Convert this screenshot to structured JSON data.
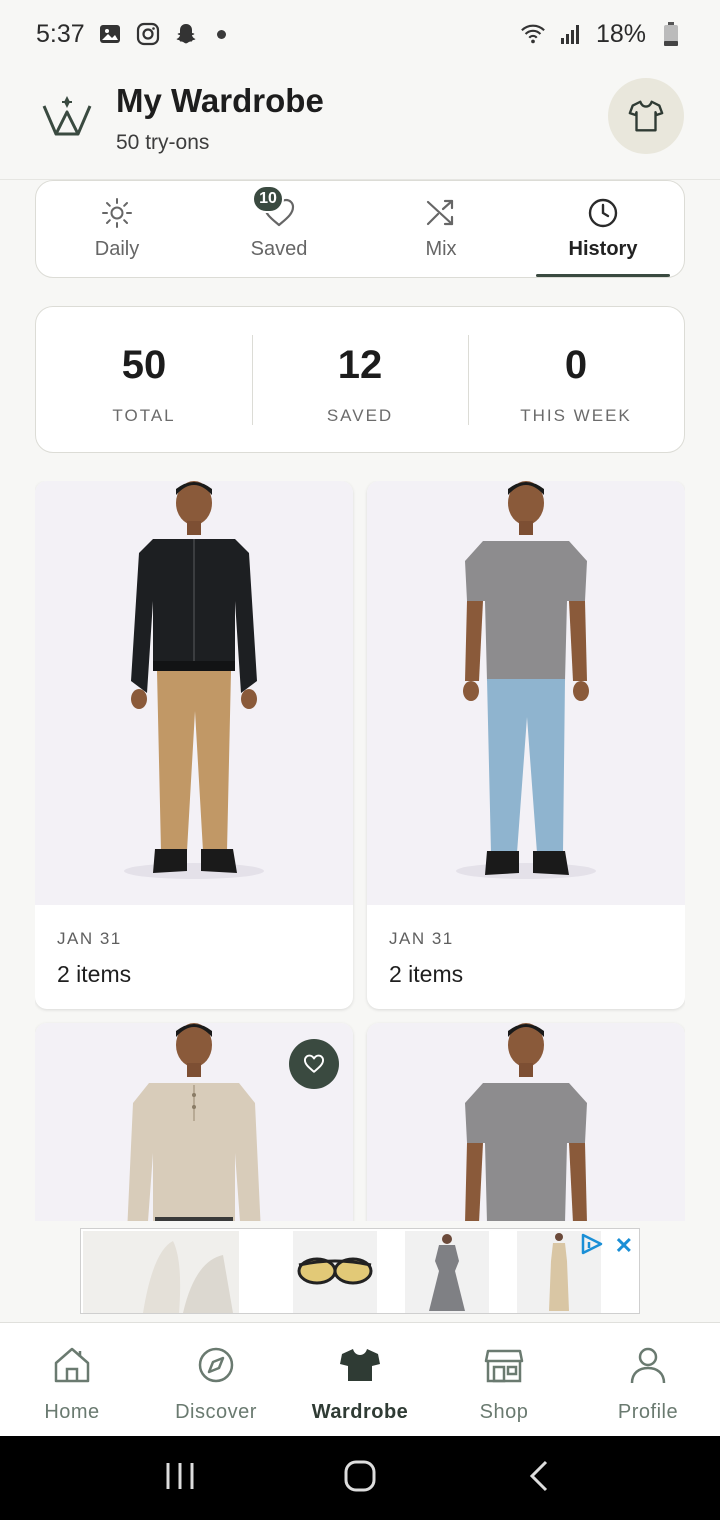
{
  "status_bar": {
    "time": "5:37",
    "battery": "18%",
    "icons": [
      "gallery-icon",
      "instagram-icon",
      "snapchat-icon",
      "dot-icon",
      "wifi-icon",
      "signal-icon",
      "battery-icon"
    ]
  },
  "header": {
    "title": "My Wardrobe",
    "subtitle": "50 try-ons",
    "logo_icon": "crown-logo-icon",
    "action_icon": "tshirt-icon"
  },
  "tabs": {
    "items": [
      {
        "label": "Daily",
        "icon": "sun-icon"
      },
      {
        "label": "Saved",
        "icon": "heart-icon",
        "badge": "10"
      },
      {
        "label": "Mix",
        "icon": "shuffle-icon"
      },
      {
        "label": "History",
        "icon": "clock-icon"
      }
    ],
    "active": "History"
  },
  "stats": {
    "items": [
      {
        "value": "50",
        "label": "TOTAL"
      },
      {
        "value": "12",
        "label": "SAVED"
      },
      {
        "value": "0",
        "label": "THIS WEEK"
      }
    ]
  },
  "cards": [
    {
      "date": "JAN 31",
      "items": "2 items",
      "outfit": "black bomber jacket, khaki chinos",
      "saved": false
    },
    {
      "date": "JAN 31",
      "items": "2 items",
      "outfit": "grey t-shirt, light blue jeans",
      "saved": false
    },
    {
      "outfit": "beige henley long sleeve",
      "saved": true
    },
    {
      "outfit": "grey t-shirt",
      "saved": false
    }
  ],
  "ad": {
    "icons": [
      "adchoices-icon",
      "close-icon"
    ]
  },
  "bottom_nav": {
    "items": [
      {
        "label": "Home",
        "icon": "home-icon"
      },
      {
        "label": "Discover",
        "icon": "compass-icon"
      },
      {
        "label": "Wardrobe",
        "icon": "tshirt-icon"
      },
      {
        "label": "Shop",
        "icon": "store-icon"
      },
      {
        "label": "Profile",
        "icon": "person-icon"
      }
    ],
    "active": "Wardrobe"
  },
  "colors": {
    "accent": "#3a4a40",
    "background": "#f7f7f5"
  }
}
